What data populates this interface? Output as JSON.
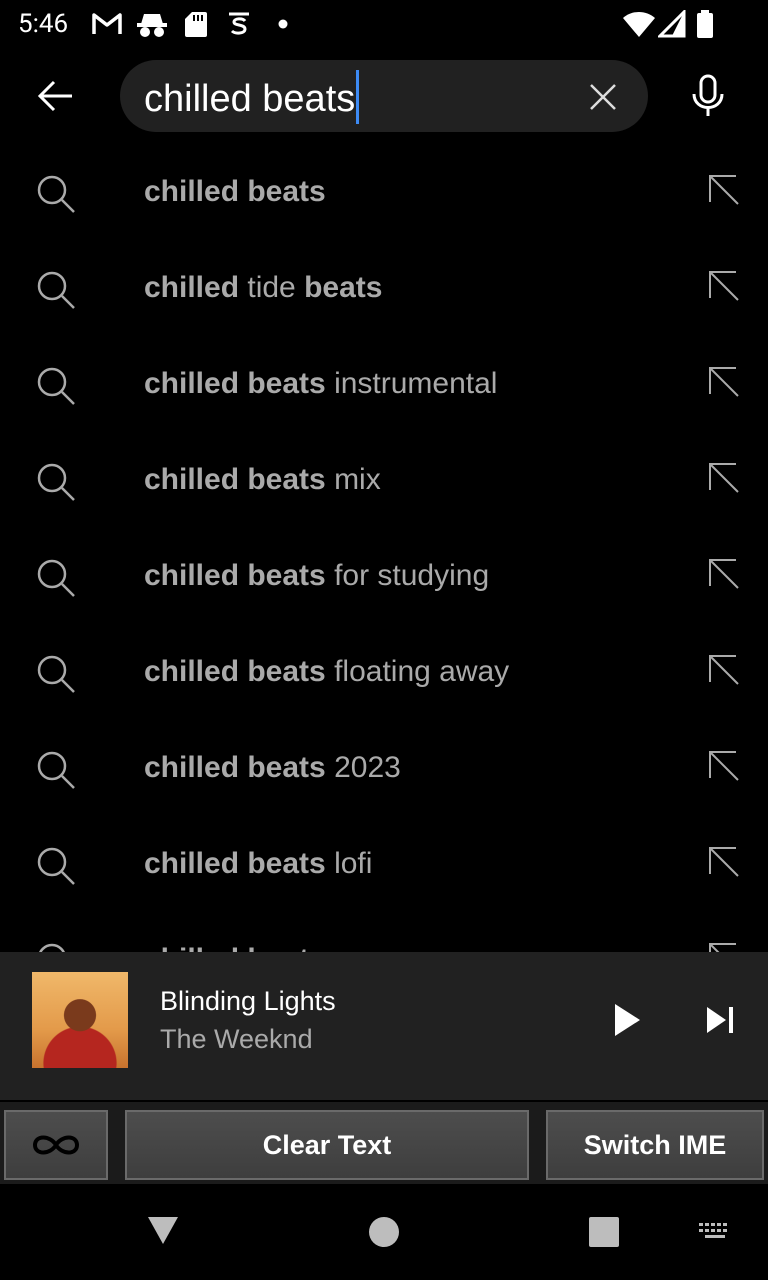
{
  "status_bar": {
    "time": "5:46",
    "left_icons": [
      "gmail-icon",
      "incognito-icon",
      "sd-card-icon",
      "vpn-s-icon",
      "dot-icon"
    ],
    "right_icons": [
      "wifi-icon",
      "signal-icon",
      "battery-icon"
    ]
  },
  "search": {
    "query": "chilled beats",
    "back_icon": "back-arrow-icon",
    "clear_icon": "close-icon",
    "voice_icon": "mic-icon"
  },
  "suggestions": [
    {
      "bold": "chilled beats",
      "rest": ""
    },
    {
      "bold": "chilled",
      "mid": " tide ",
      "bold2": "beats"
    },
    {
      "bold": "chilled beats",
      "rest": " instrumental"
    },
    {
      "bold": "chilled beats",
      "rest": " mix"
    },
    {
      "bold": "chilled beats",
      "rest": " for studying"
    },
    {
      "bold": "chilled beats",
      "rest": " floating away"
    },
    {
      "bold": "chilled beats",
      "rest": " 2023"
    },
    {
      "bold": "chilled beats",
      "rest": " lofi"
    },
    {
      "bold": "chilled beats",
      "rest": " ..."
    }
  ],
  "mini_player": {
    "title": "Blinding Lights",
    "artist": "The Weeknd",
    "play_icon": "play-icon",
    "next_icon": "skip-next-icon"
  },
  "ime_bar": {
    "infinity_icon": "infinity-icon",
    "clear_text": "Clear Text",
    "switch_ime": "Switch IME"
  },
  "nav_bar": {
    "icons": [
      "back-triangle-icon",
      "home-circle-icon",
      "recents-square-icon",
      "keyboard-icon"
    ]
  }
}
